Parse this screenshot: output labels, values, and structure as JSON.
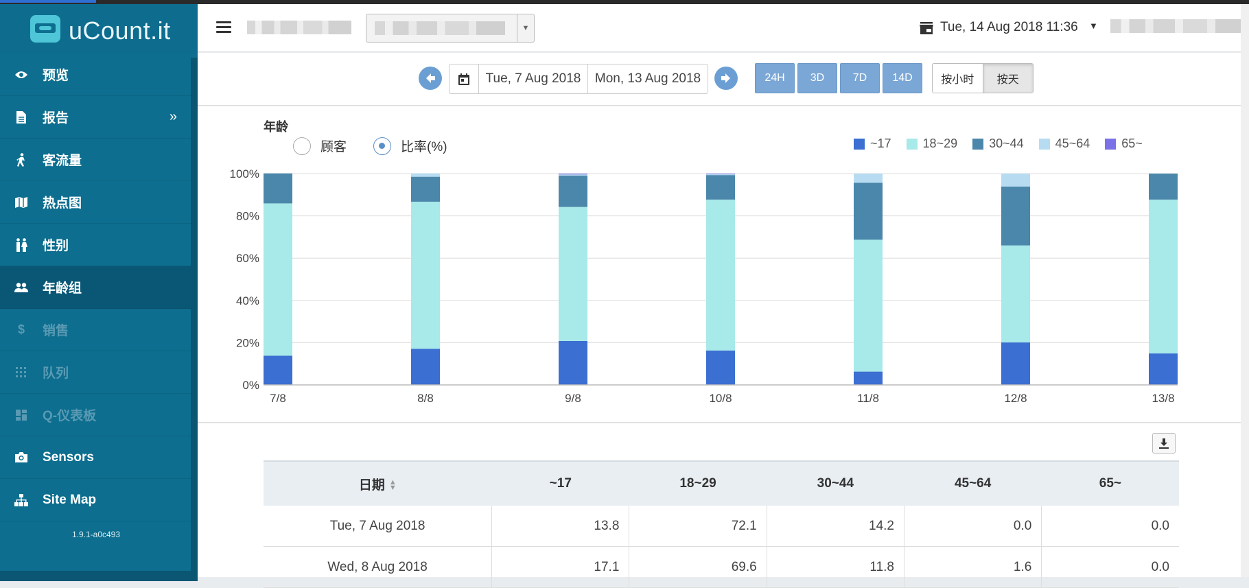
{
  "app": {
    "name": "uCount.it",
    "version": "1.9.1-a0c493"
  },
  "header": {
    "datetime": "Tue, 14 Aug 2018 11:36"
  },
  "sidebar": {
    "items": [
      {
        "label": "预览",
        "icon": "eye-icon"
      },
      {
        "label": "报告",
        "icon": "document-icon",
        "arrow": "»"
      },
      {
        "label": "客流量",
        "icon": "walking-icon"
      },
      {
        "label": "热点图",
        "icon": "map-icon"
      },
      {
        "label": "性别",
        "icon": "gender-icon"
      },
      {
        "label": "年龄组",
        "icon": "users-icon",
        "active": true
      },
      {
        "label": "销售",
        "icon": "dollar-icon",
        "disabled": true
      },
      {
        "label": "队列",
        "icon": "grid-dots-icon",
        "disabled": true
      },
      {
        "label": "Q-仪表板",
        "icon": "dashboard-icon",
        "disabled": true
      },
      {
        "label": "Sensors",
        "icon": "camera-icon"
      },
      {
        "label": "Site Map",
        "icon": "sitemap-icon"
      }
    ]
  },
  "toolbar": {
    "start_date": "Tue, 7 Aug 2018",
    "end_date": "Mon, 13 Aug 2018",
    "ranges": [
      "24H",
      "3D",
      "7D",
      "14D"
    ],
    "mode_hour": "按小时",
    "mode_day": "按天",
    "active_mode": "按天"
  },
  "chart": {
    "radio_visitors": "顾客",
    "radio_ratio": "比率(%)",
    "selected": "比率(%)"
  },
  "chart_data": {
    "type": "bar",
    "stacked": true,
    "title": "年龄",
    "categories": [
      "7/8",
      "8/8",
      "9/8",
      "10/8",
      "11/8",
      "12/8",
      "13/8"
    ],
    "y_ticks": [
      "0%",
      "20%",
      "40%",
      "60%",
      "80%",
      "100%"
    ],
    "ylim": [
      0,
      100
    ],
    "grid": true,
    "legend_position": "top-right",
    "series": [
      {
        "name": "~17",
        "color": "#3b6fd1",
        "values": [
          13.8,
          17.1,
          20.8,
          16.3,
          6.3,
          20.1,
          14.9
        ]
      },
      {
        "name": "18~29",
        "color": "#a8e9e9",
        "values": [
          72.1,
          69.6,
          63.4,
          71.4,
          62.4,
          45.9,
          72.8
        ]
      },
      {
        "name": "30~44",
        "color": "#4a87ab",
        "values": [
          14.2,
          11.8,
          14.9,
          11.6,
          27.0,
          27.9,
          12.3
        ]
      },
      {
        "name": "45~64",
        "color": "#b7dcf2",
        "values": [
          0.0,
          1.6,
          0.5,
          0.4,
          4.3,
          6.1,
          0.0
        ]
      },
      {
        "name": "65~",
        "color": "#7b72e8",
        "values": [
          0.0,
          0.0,
          0.4,
          0.3,
          0.0,
          0.0,
          0.0
        ]
      }
    ]
  },
  "table": {
    "headers": [
      "日期",
      "~17",
      "18~29",
      "30~44",
      "45~64",
      "65~"
    ],
    "rows": [
      [
        "Tue, 7 Aug 2018",
        "13.8",
        "72.1",
        "14.2",
        "0.0",
        "0.0"
      ],
      [
        "Wed, 8 Aug 2018",
        "17.1",
        "69.6",
        "11.8",
        "1.6",
        "0.0"
      ]
    ]
  }
}
